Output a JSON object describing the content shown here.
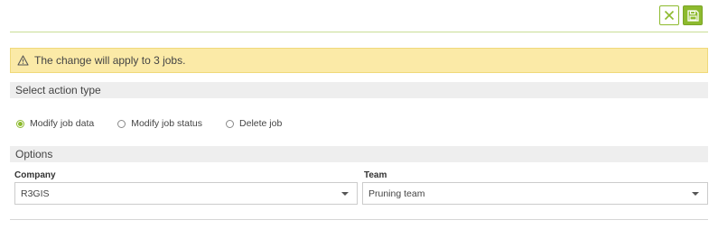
{
  "toolbar": {
    "close_icon": "close-icon",
    "save_icon": "save-icon",
    "accent_color": "#8dba2e"
  },
  "alert": {
    "icon": "warning-icon",
    "text": "The change will apply to 3 jobs.",
    "background": "#fbeaa7"
  },
  "action_section": {
    "title": "Select action type",
    "options": [
      {
        "label": "Modify job data",
        "selected": true
      },
      {
        "label": "Modify job status",
        "selected": false
      },
      {
        "label": "Delete job",
        "selected": false
      }
    ]
  },
  "options_section": {
    "title": "Options",
    "company": {
      "label": "Company",
      "value": "R3GIS"
    },
    "team": {
      "label": "Team",
      "value": "Pruning team"
    }
  }
}
